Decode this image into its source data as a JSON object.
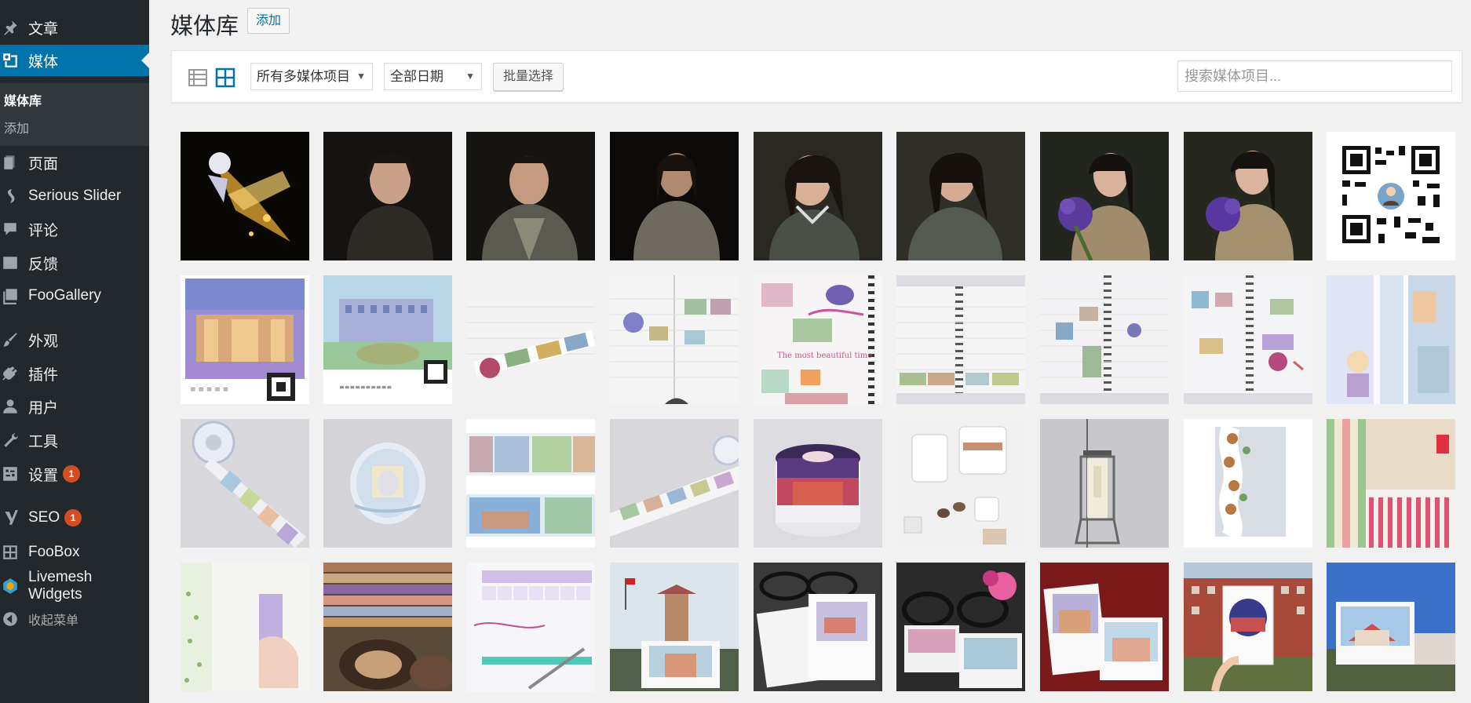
{
  "sidebar": {
    "posts": "文章",
    "media": "媒体",
    "media_library": "媒体库",
    "media_add": "添加",
    "pages": "页面",
    "serious_slider": "Serious Slider",
    "comments": "评论",
    "feedback": "反馈",
    "foogallery": "FooGallery",
    "appearance": "外观",
    "plugins": "插件",
    "users": "用户",
    "tools": "工具",
    "settings": "设置",
    "settings_badge": "1",
    "seo": "SEO",
    "seo_badge": "1",
    "foobox": "FooBox",
    "livemesh": "Livemesh Widgets",
    "collapse": "收起菜单"
  },
  "header": {
    "title": "媒体库",
    "add_button": "添加"
  },
  "toolbar": {
    "filter_type": "所有多媒体项目",
    "filter_date": "全部日期",
    "bulk_select": "批量选择",
    "search_placeholder": "搜索媒体项目..."
  },
  "colors": {
    "accent": "#0073aa",
    "sidebar_bg": "#23282d",
    "submenu_bg": "#32373c",
    "badge": "#d54e21"
  }
}
